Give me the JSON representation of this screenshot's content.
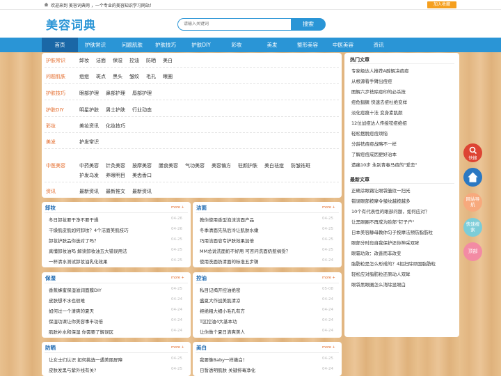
{
  "topbar": {
    "welcome": "欢迎来到 美容词典网 ，一个专业的美容知识学习网站！",
    "favorite": "加入收藏"
  },
  "header": {
    "logo": "美容词典",
    "search_placeholder": "请输入关键词",
    "search_button": "搜索"
  },
  "nav": [
    "首页",
    "护肤常识",
    "问题肌肤",
    "护肤技巧",
    "护肤DIY",
    "彩妆",
    "美发",
    "整形美容",
    "中医美容",
    "资讯"
  ],
  "categories": [
    {
      "label": "护肤常识",
      "links": [
        "卸妆",
        "洁面",
        "保湿",
        "控油",
        "防晒",
        "美白"
      ]
    },
    {
      "label": "问题肌肤",
      "links": [
        "痘痘",
        "斑点",
        "黑头",
        "皱纹",
        "毛孔",
        "眼圈"
      ]
    },
    {
      "label": "护肤技巧",
      "links": [
        "眼部护理",
        "鼻部护理",
        "唇部护理"
      ]
    },
    {
      "label": "护肤DIY",
      "links": [
        "明星护肤",
        "男士护肤",
        "行业动态"
      ]
    },
    {
      "label": "彩妆",
      "links": [
        "美妆资讯",
        "化妆技巧"
      ]
    },
    {
      "label": "美发",
      "links": [
        "护发常识"
      ]
    },
    {
      "label": "中医美容",
      "links": [
        "中药美容",
        "针灸美容",
        "按摩美容",
        "膳食美容",
        "气功美容",
        "美容偏方",
        "驻颜护肤",
        "美白祛痘",
        "防皱祛斑",
        "护发乌发",
        "养眼明目",
        "美齿香口"
      ]
    },
    {
      "label": "资讯",
      "links": [
        "最新资讯",
        "最新推文",
        "最新资讯"
      ]
    }
  ],
  "sidebar": {
    "hot_title": "热门文章",
    "hot": [
      "专家级达人推荐A醇解决痘痘",
      "从根源看手臂出痘痘",
      "图解六步祛除痘印的必杀技",
      "痘危猖獗 快速去痘杜绝变样",
      "淡化痘痕十法 变身素肌颜",
      "12位战痘达人传授祛痘绝招",
      "轻松摆脱痘痘烦恼",
      "分龄祛痘痘战略不一样",
      "了解痘痘成因更好治本",
      "遗痛10步 永别青春马痘的\"爱恋\""
    ],
    "latest_title": "最新文章",
    "latest": [
      "正确涂眼霜让眼袋皱纹一扫光",
      "错误眼部按摩令皱纹越按越多",
      "10个有代表性的眼部问题，如何应对？",
      "让黑眼圈不再成为脸部\"钉子户\"",
      "日本美容静母教你匀子按摩法预防脂肪粒",
      "眼部分时段自我保护还你神采双眸",
      "眼霜功效：改善而非改变",
      "脂肪粒是怎么形成的？4招扫除顽固脂肪粒",
      "轻松应对脂肪粒还原动人双眸",
      "眼袋黑眼圈怎么消除显眼白"
    ]
  },
  "boxes": [
    {
      "title": "卸妆",
      "more": "more +",
      "items": [
        [
          "冬日卸妆要干净不要干燥",
          "04-26"
        ],
        [
          "干燥肌皮肌如何卸妆？4个洁面美肌技巧",
          "04-26"
        ],
        [
          "卸妆护肤品你选对了吗？",
          "04-25"
        ],
        [
          "真懂卸妆油吗 解读卸妆油五大错误用法",
          "04-25"
        ],
        [
          "一杯清水测试卸妆油乳化效果",
          "04-25"
        ]
      ]
    },
    {
      "title": "洁面",
      "more": "more +",
      "items": [
        [
          "教你使用香型泡沫洁面产品",
          "04-25"
        ],
        [
          "冬季清面先热后冷让肌肤水嫩",
          "04-25"
        ],
        [
          "巧用洁面皂专护肤效果加倍",
          "04-25"
        ],
        [
          "MM总说洗面奶不好用 可否问洗面奶惹祸受？",
          "04-25"
        ],
        [
          "使用洗面奶清面的标准五步骤",
          "04-24"
        ]
      ]
    },
    {
      "title": "保湿",
      "more": "more +",
      "items": [
        [
          "香蕉蜂蜜保湿滋润面膜DIY",
          "04-25"
        ],
        [
          "皮肤想不水也很难",
          "04-24"
        ],
        [
          "如何过一个清爽的夏天",
          "04-24"
        ],
        [
          "保湿功课让你美容事半功倍",
          "04-24"
        ],
        [
          "肌肤补水和保湿 你需要了解误区",
          "04-24"
        ]
      ]
    },
    {
      "title": "控油",
      "more": "more +",
      "items": [
        [
          "私目记揭开控油绝密",
          "05-08"
        ],
        [
          "盛夏大作战美肌清凉",
          "04-24"
        ],
        [
          "拒绝粗大细小毛孔有方",
          "04-24"
        ],
        [
          "T区控油4大基本功",
          "04-24"
        ],
        [
          "让你做个夏日清爽美人",
          "04-24"
        ]
      ]
    },
    {
      "title": "防晒",
      "more": "more +",
      "items": [
        [
          "让女士们认识 如何挑选一遇美丽屏障",
          "04-25"
        ],
        [
          "皮肤发黑与紫外线有关?",
          "04-25"
        ]
      ]
    },
    {
      "title": "美白",
      "more": "more +",
      "items": [
        [
          "我要像Baby一样嫩白！",
          "04-25"
        ],
        [
          "日皙透明肌肤 关键排毒净化",
          "04-24"
        ]
      ]
    }
  ],
  "floats": [
    {
      "label": "快搜",
      "color": "#dd4433"
    },
    {
      "label": "",
      "color": "#2b78c2"
    },
    {
      "label": "网站导航",
      "color": "#f7a97d"
    },
    {
      "label": "快速搜索",
      "color": "#7ccdd8"
    },
    {
      "label": "顶部",
      "color": "#f38ba4"
    }
  ]
}
